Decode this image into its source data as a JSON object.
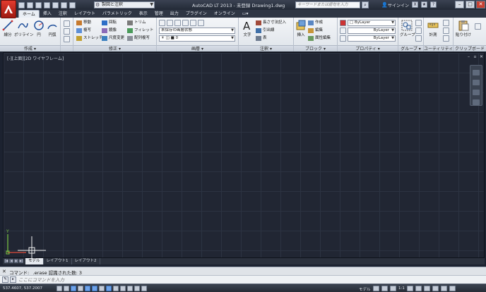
{
  "titlebar": {
    "title": "AutoCAD LT 2013 - 未登録   Drawing1.dwg",
    "workspace": "製図と注釈",
    "search_placeholder": "キーワードまたは語句を入力",
    "signin": "サインイン"
  },
  "ribbon_tabs": [
    "ホーム",
    "挿入",
    "注釈",
    "レイアウト",
    "パラメトリック",
    "表示",
    "管理",
    "出力",
    "プラグイン",
    "オンライン"
  ],
  "panels": {
    "draw": {
      "title": "作成 ▾",
      "line": "線分",
      "polyline": "ポリライン",
      "circle": "円",
      "arc": "円弧"
    },
    "modify": {
      "title": "修正 ▾",
      "items": [
        "移動",
        "回転",
        "トリム",
        "複写",
        "鏡像",
        "フィレット",
        "ストレッチ",
        "尺度変更",
        "配列複写"
      ]
    },
    "layers": {
      "title": "画層 ▾",
      "current_state": "未保存の画層状態",
      "layer_value": "0"
    },
    "annotation": {
      "title": "注釈 ▾",
      "text": "文字",
      "mtext": "長さ寸法記入",
      "leader": "引出線",
      "table": "表"
    },
    "block": {
      "title": "ブロック ▾",
      "insert": "挿入",
      "create": "作成",
      "edit": "編集",
      "attr": "属性編集"
    },
    "properties": {
      "title": "プロパティ ▾",
      "color": "ByLayer",
      "linetype": "ByLayer",
      "lineweight": "ByLayer"
    },
    "groups": {
      "title": "グループ ▾",
      "group": "グループ"
    },
    "utilities": {
      "title": "ユーティリティ ▾",
      "measure": "計測"
    },
    "clipboard": {
      "title": "クリップボード",
      "paste": "貼り付け"
    }
  },
  "layout_tabs": [
    "モデル",
    "レイアウト1",
    "レイアウト2"
  ],
  "command": {
    "history": "コマンド: _.erase  認識された数: 3",
    "placeholder": "ここにコマンドを入力"
  },
  "status": {
    "coords": "537.4607, 537.2007",
    "model": "モデル",
    "scale": "1:1"
  },
  "colors": {
    "canvas_bg": "#212633",
    "ribbon_bg": "#eef1f5",
    "title_bg": "#2a313d",
    "accent": "#6fa3e8"
  }
}
